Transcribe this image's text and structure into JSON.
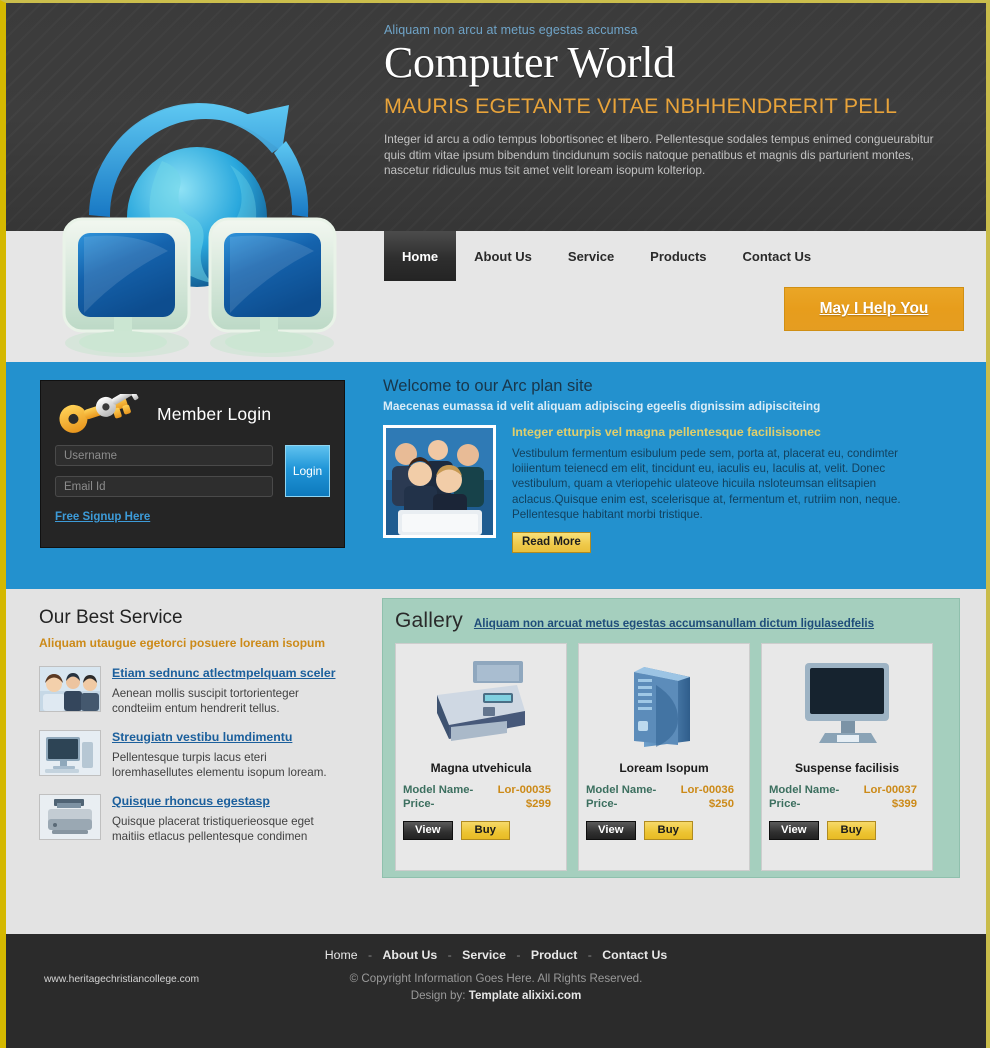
{
  "header": {
    "tagline": "Aliquam non arcu at metus egestas accumsa",
    "title": "Computer World",
    "subtitle": "MAURIS EGETANTE VITAE NBHHENDRERIT PELL",
    "paragraph": "Integer id arcu a odio tempus lobortisonec et libero. Pellentesque sodales tempus enimed congueurabitur quis dtim vitae ipsum bibendum tincidunum sociis natoque penatibus et magnis dis parturient montes, nascetur ridiculus mus tsit amet velit loream isopum kolteriop.",
    "logo_icon": "two-monitors-globe-logo"
  },
  "nav": {
    "items": [
      {
        "label": "Home",
        "active": true
      },
      {
        "label": "About Us",
        "active": false
      },
      {
        "label": "Service",
        "active": false
      },
      {
        "label": "Products",
        "active": false
      },
      {
        "label": "Contact Us",
        "active": false
      }
    ],
    "help_button": "May I Help You"
  },
  "login": {
    "title": "Member Login",
    "icon": "keys-icon",
    "username_placeholder": "Username",
    "username_value": "",
    "email_placeholder": "Email Id",
    "email_value": "",
    "login_button": "Login",
    "signup_link": "Free Signup Here"
  },
  "welcome": {
    "heading": "Welcome to our Arc plan site",
    "subheading": "Maecenas eumassa id velit aliquam adipiscing egeelis dignissim adipisciteing",
    "photo_icon": "team-celebrating-photo",
    "article_title": "Integer etturpis vel magna pellentesque facilisisonec",
    "article_body": "Vestibulum fermentum esibulum pede sem, porta at, placerat eu, condimter loiiientum teienecd em elit, tincidunt eu, iaculis eu, Iaculis at, velit. Donec vestibulum, quam a vteriopehic ulateove hicuila nsloteumsan elitsapien aclacus.Quisque enim est, scelerisque at, fermentum et, rutriim non, neque. Pellentesque habitant morbi tristique.",
    "read_more": "Read More"
  },
  "services": {
    "heading": "Our Best Service",
    "subheading": "Aliquam utaugue egetorci posuere loream isopum",
    "items": [
      {
        "thumb_icon": "business-team-photo",
        "title": "Etiam sednunc atlectmpelquam sceler",
        "desc": "Aenean mollis suscipit tortorienteger condteiim entum hendrerit tellus."
      },
      {
        "thumb_icon": "desktop-computer-photo",
        "title": "Streugiatn vestibu lumdimentu",
        "desc": "Pellentesque turpis lacus eteri loremhasellutes elementu isopum loream."
      },
      {
        "thumb_icon": "printer-photo",
        "title": "Quisque rhoncus egestasp",
        "desc": "Quisque placerat tristiquerieosque eget maitiis etlacus pellentesque condimen"
      }
    ]
  },
  "gallery": {
    "title": "Gallery",
    "link": "Aliquam non arcuat metus egestas accumsanullam dictum ligulasedfelis",
    "model_label": "Model Name-",
    "price_label": "Price-",
    "view_button": "View",
    "buy_button": "Buy",
    "products": [
      {
        "image_icon": "printer-icon",
        "name": "Magna utvehicula",
        "model": "Lor-00035",
        "price": "$299"
      },
      {
        "image_icon": "computer-tower-icon",
        "name": "Loream Isopum",
        "model": "Lor-00036",
        "price": "$250"
      },
      {
        "image_icon": "lcd-monitor-icon",
        "name": "Suspense facilisis",
        "model": "Lor-00037",
        "price": "$399"
      }
    ]
  },
  "footer": {
    "links": [
      "Home",
      "About Us",
      "Service",
      "Product",
      "Contact Us"
    ],
    "separator": "-",
    "copyright": "© Copyright Information Goes Here. All Rights Reserved.",
    "design_prefix": "Design by:",
    "design_by": "Template alixixi.com",
    "site_url": "www.heritagechristiancollege.com"
  },
  "colors": {
    "accent_orange": "#e8a33a",
    "blue_band": "#2391ce",
    "gallery_panel": "#a5cfbe",
    "header_dark": "#3b3b3b",
    "footer_dark": "#2b2b2b",
    "frame_gold": "#d4b800"
  }
}
